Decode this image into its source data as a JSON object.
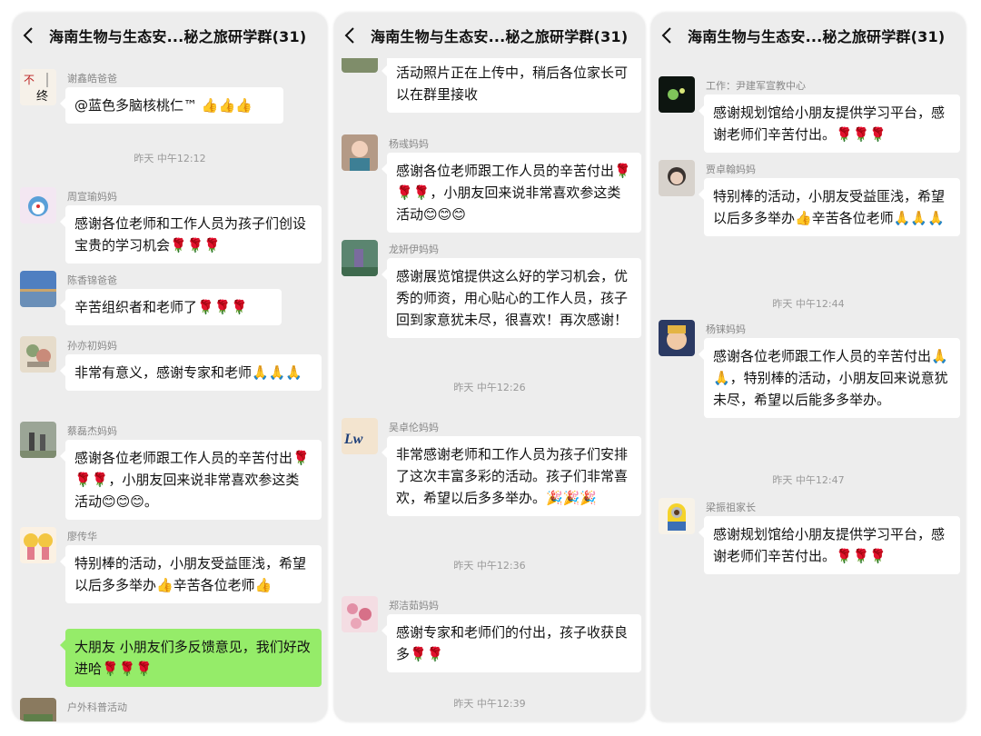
{
  "panels": [
    {
      "title": "海南生物与生态安...秘之旅研学群(31)",
      "messages": [
        {
          "sender": "谢鑫皓爸爸",
          "text": "@蓝色多脑核桃仁™ 👍👍👍"
        },
        {
          "timestamp": "昨天 中午12:12"
        },
        {
          "sender": "周宣瑜妈妈",
          "text": "感谢各位老师和工作人员为孩子们创设宝贵的学习机会🌹🌹🌹"
        },
        {
          "sender": "陈香锦爸爸",
          "text": "辛苦组织者和老师了🌹🌹🌹"
        },
        {
          "sender": "孙亦初妈妈",
          "text": "非常有意义，感谢专家和老师🙏🙏🙏"
        },
        {
          "sender": "蔡磊杰妈妈",
          "text": "感谢各位老师跟工作人员的辛苦付出🌹🌹🌹，小朋友回来说非常喜欢参这类活动😊😊😊。"
        },
        {
          "sender": "廖传华",
          "text": "特别棒的活动，小朋友受益匪浅，希望以后多多举办👍辛苦各位老师👍"
        },
        {
          "text": "大朋友 小朋友们多反馈意见，我们好改进哈🌹🌹🌹"
        },
        {
          "sender": "户外科普活动"
        }
      ]
    },
    {
      "title": "海南生物与生态安...秘之旅研学群(31)",
      "messages": [
        {
          "text": "活动照片正在上传中，稍后各位家长可以在群里接收"
        },
        {
          "sender": "杨彧妈妈",
          "text": "感谢各位老师跟工作人员的辛苦付出🌹🌹🌹，小朋友回来说非常喜欢参这类活动😊😊😊"
        },
        {
          "sender": "龙妍伊妈妈",
          "text": "感谢展览馆提供这么好的学习机会，优秀的师资，用心贴心的工作人员，孩子回到家意犹未尽，很喜欢！再次感谢！"
        },
        {
          "timestamp": "昨天 中午12:26"
        },
        {
          "sender": "吴卓伦妈妈",
          "text": "非常感谢老师和工作人员为孩子们安排了这次丰富多彩的活动。孩子们非常喜欢，希望以后多多举办。🎉🎉🎉"
        },
        {
          "timestamp": "昨天 中午12:36"
        },
        {
          "sender": "郑洁茹妈妈",
          "text": "感谢专家和老师们的付出，孩子收获良多🌹🌹"
        },
        {
          "timestamp": "昨天 中午12:39"
        }
      ]
    },
    {
      "title": "海南生物与生态安...秘之旅研学群(31)",
      "messages": [
        {
          "sender": "工作：尹建军宣教中心",
          "text": "感谢规划馆给小朋友提供学习平台，感谢老师们辛苦付出。🌹🌹🌹"
        },
        {
          "sender": "贾卓翰妈妈",
          "text": "特别棒的活动，小朋友受益匪浅，希望以后多多举办👍辛苦各位老师🙏🙏🙏"
        },
        {
          "timestamp": "昨天 中午12:44"
        },
        {
          "sender": "杨铼妈妈",
          "text": "感谢各位老师跟工作人员的辛苦付出🙏🙏，特别棒的活动，小朋友回来说意犹未尽，希望以后能多多举办。"
        },
        {
          "timestamp": "昨天 中午12:47"
        },
        {
          "sender": "梁振祖家长",
          "text": "感谢规划馆给小朋友提供学习平台，感谢老师们辛苦付出。🌹🌹🌹"
        }
      ]
    }
  ],
  "colors": {
    "panel_bg": "#ededed",
    "bubble_white": "#ffffff",
    "bubble_green": "#95ec69"
  },
  "icons": {
    "back": "chevron-left-icon"
  }
}
